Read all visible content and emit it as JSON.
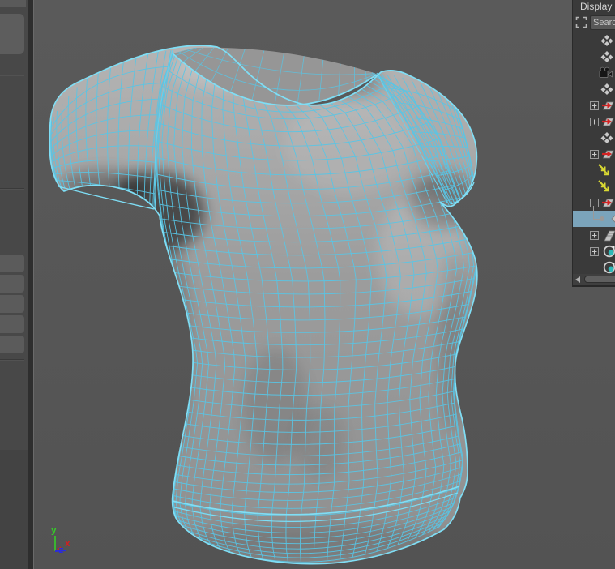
{
  "outliner": {
    "menu_label": "Display",
    "search": {
      "placeholder": "Search...",
      "value": ""
    },
    "rows": [
      {
        "icon": "set"
      },
      {
        "icon": "set"
      },
      {
        "icon": "camera"
      },
      {
        "icon": "set"
      },
      {
        "expand": "plus",
        "icon": "transform"
      },
      {
        "expand": "plus",
        "icon": "transform"
      },
      {
        "icon": "set"
      },
      {
        "expand": "plus",
        "icon": "transform"
      },
      {
        "icon": "ik-arrows"
      },
      {
        "icon": "ik-arrows"
      },
      {
        "expand": "minus",
        "icon": "transform"
      },
      {
        "icon": "mesh",
        "selected": true,
        "connector": true
      },
      {
        "expand": "plus",
        "icon": "layers"
      },
      {
        "expand": "plus",
        "icon": "material"
      },
      {
        "icon": "material"
      }
    ]
  },
  "viewport": {
    "object": "t-shirt-polygon-mesh-wireframe",
    "axis_labels": {
      "y": "y",
      "z": "z",
      "x": "x"
    }
  },
  "colors": {
    "wireframe": "#58c6e6",
    "wireframe_bright": "#7fdef5",
    "seam": "#68d0ec",
    "selection_blue": "#7ba4bb",
    "axis_y": "#35cc28",
    "axis_z": "#2b2bdd",
    "axis_x": "#d41f1f",
    "viewport_bg": "#575757",
    "panel_bg": "#3a3a3a",
    "icon_yellow": "#d8d832",
    "icon_red": "#d42222",
    "icon_teal": "#2fb8b8"
  }
}
